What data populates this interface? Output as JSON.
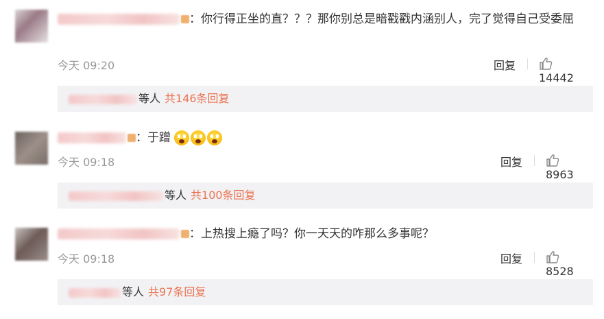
{
  "comments": [
    {
      "text": "：你行得正坐的直？？？那你别总是暗戳戳内涵别人，完了觉得自己受委屈",
      "time": "今天 09:20",
      "reply_label": "回复",
      "likes": "14442",
      "sub": {
        "people": "等人",
        "count_link": "共146条回复"
      }
    },
    {
      "text": "：于蹭",
      "emoji_icons": [
        "scared-face-emoji",
        "scared-face-emoji",
        "scared-face-emoji"
      ],
      "time": "今天 09:18",
      "reply_label": "回复",
      "likes": "8963",
      "sub": {
        "people": "等人",
        "count_link": "共100条回复"
      }
    },
    {
      "text": "：上热搜上瘾了吗？你一天天的咋那么多事呢？",
      "time": "今天 09:18",
      "reply_label": "回复",
      "likes": "8528",
      "sub": {
        "people": "等人",
        "count_link": "共97条回复"
      }
    }
  ],
  "colors": {
    "accent": "#eb7350",
    "meta_gray": "#999999",
    "sub_bg": "#f2f2f5"
  },
  "icons": {
    "like": "thumbs-up-icon"
  }
}
